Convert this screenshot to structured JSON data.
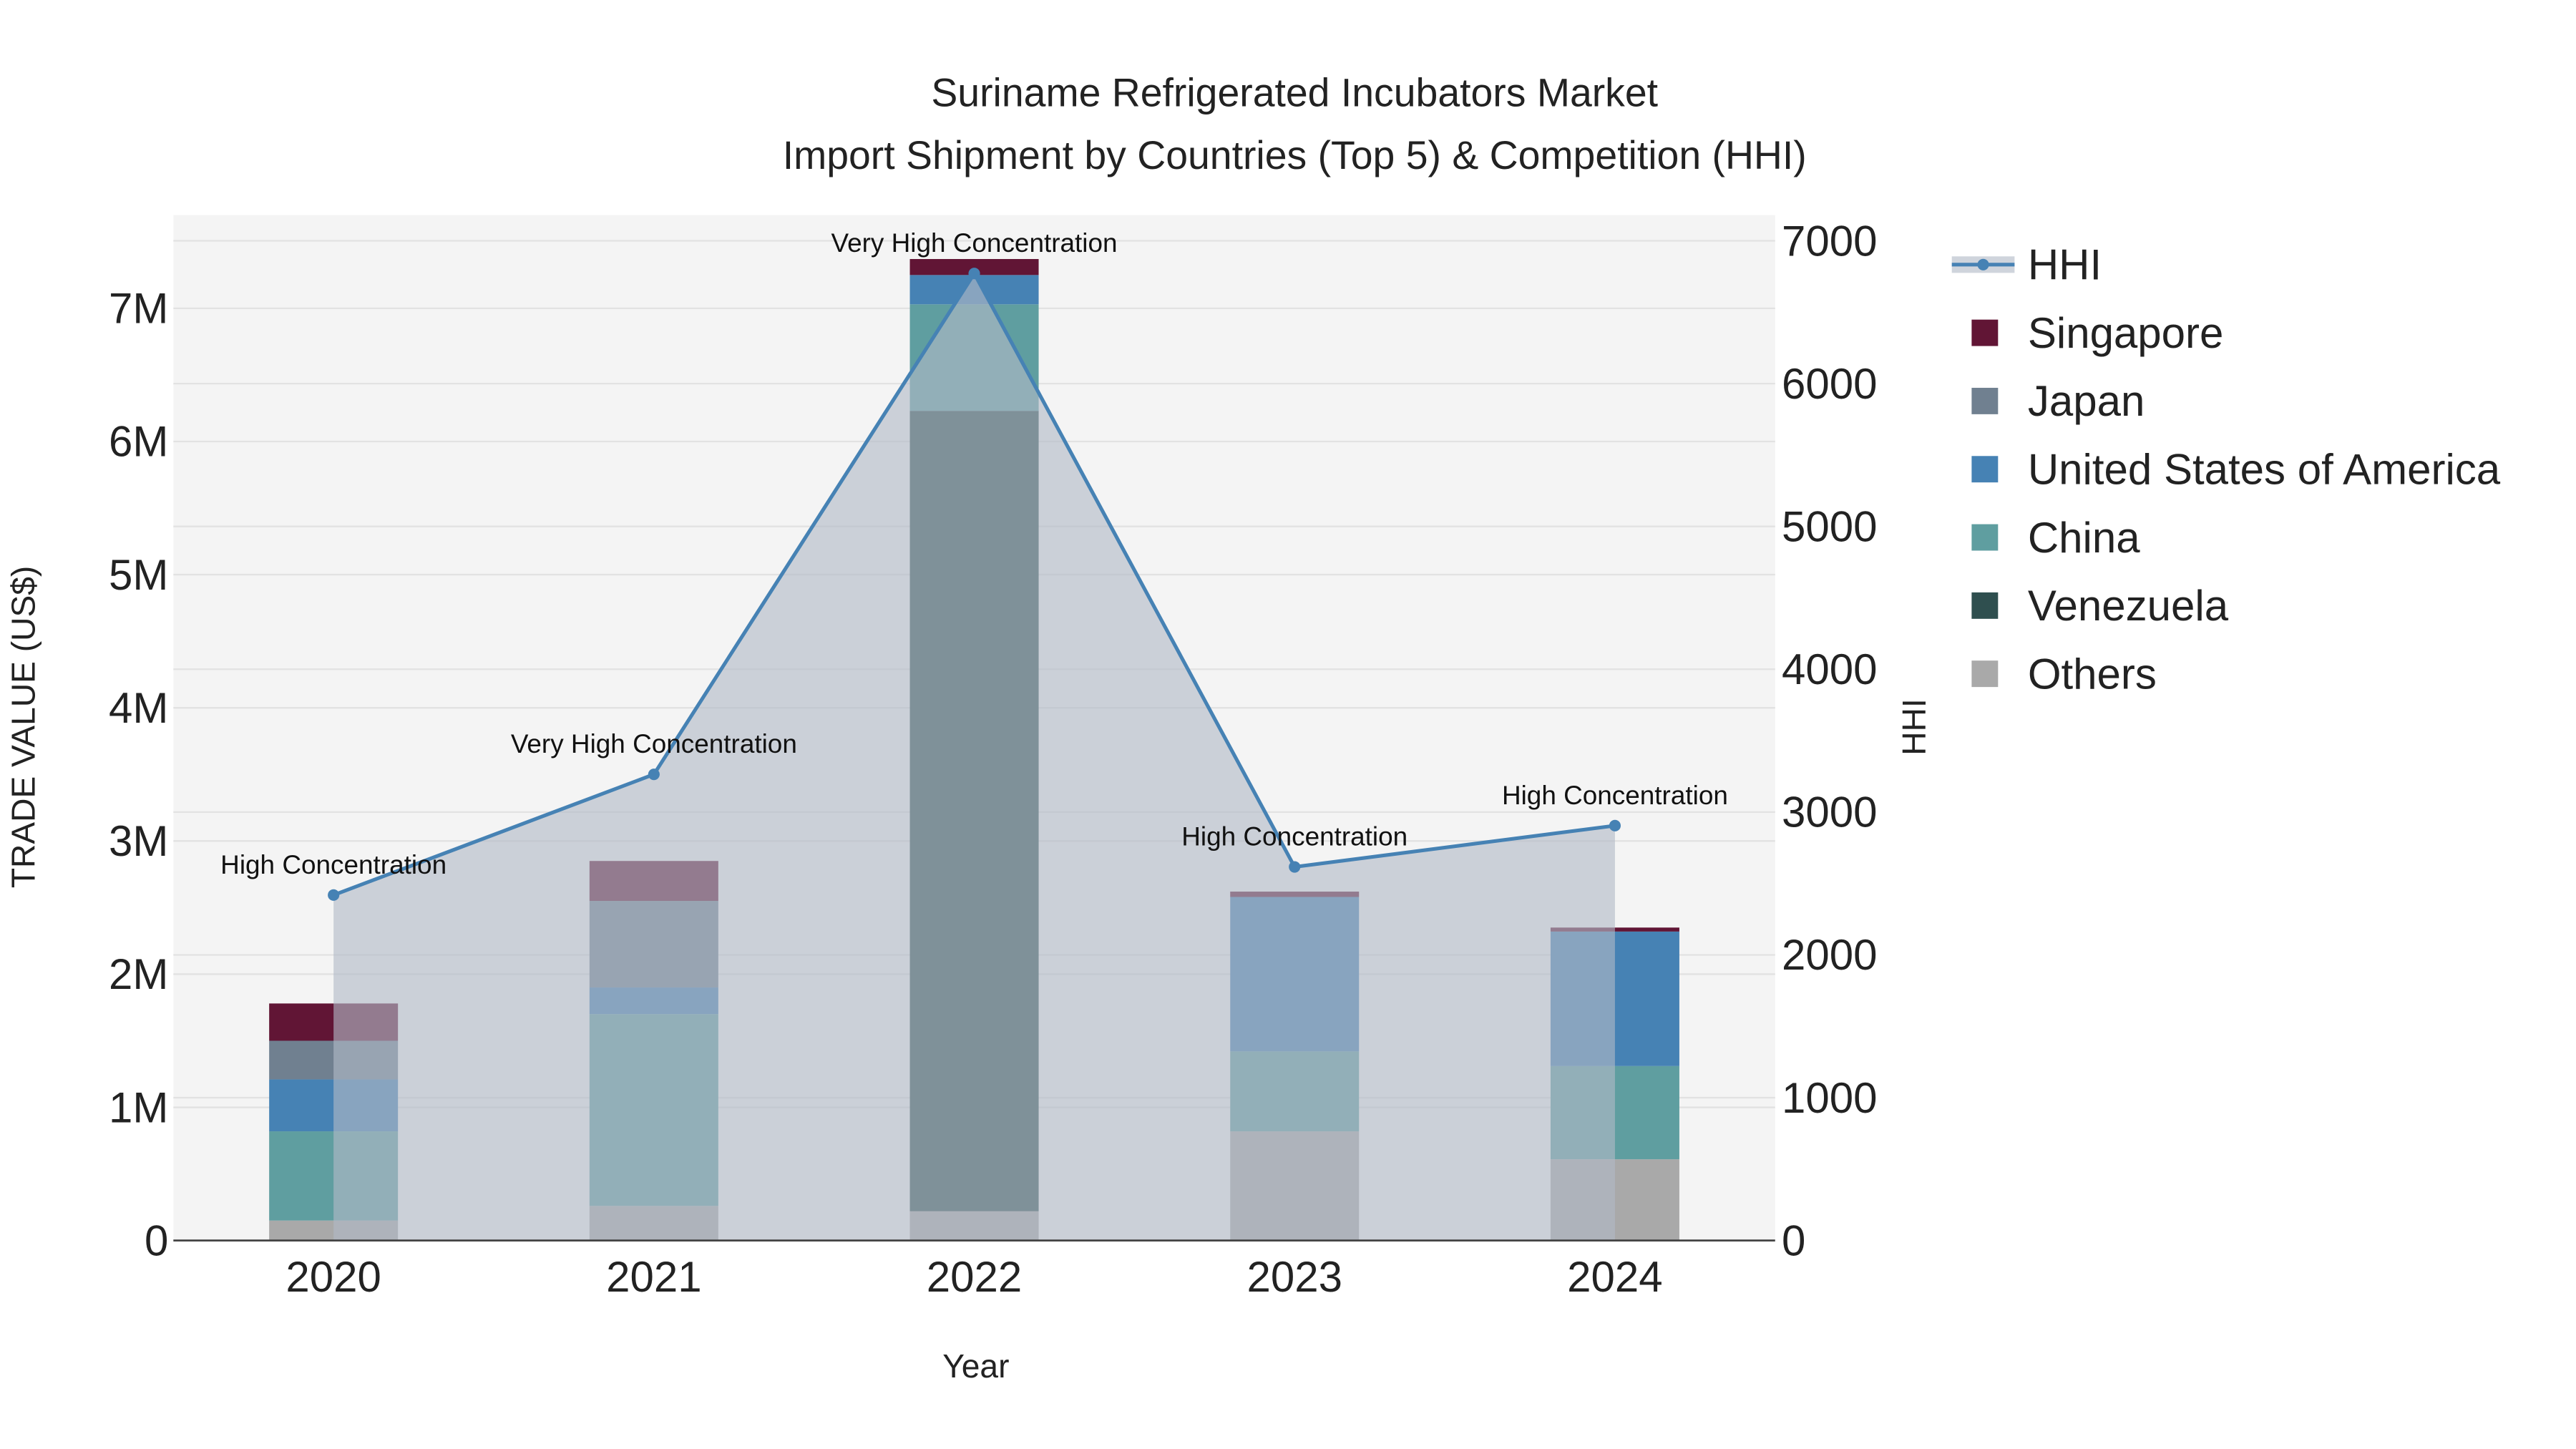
{
  "chart_data": {
    "type": "bar",
    "title_line1": "Suriname Refrigerated Incubators Market",
    "title_line2": "Import Shipment by Countries (Top 5) & Competition (HHI)",
    "xlabel": "Year",
    "ylabel": "TRADE VALUE (US$)",
    "y2label": "HHI",
    "categories": [
      "2020",
      "2021",
      "2022",
      "2023",
      "2024"
    ],
    "ylim": [
      0,
      7700000
    ],
    "y2lim": [
      0,
      7180
    ],
    "yticks": [
      0,
      1000000,
      2000000,
      3000000,
      4000000,
      5000000,
      6000000,
      7000000
    ],
    "ytick_labels": [
      "0",
      "1M",
      "2M",
      "3M",
      "4M",
      "5M",
      "6M",
      "7M"
    ],
    "y2ticks": [
      0,
      1000,
      2000,
      3000,
      4000,
      5000,
      6000,
      7000
    ],
    "y2tick_labels": [
      "0",
      "1000",
      "2000",
      "3000",
      "4000",
      "5000",
      "6000",
      "7000"
    ],
    "stacked": true,
    "series": [
      {
        "name": "Others",
        "color": "#a9a9a9",
        "values": [
          150000,
          260000,
          220000,
          820000,
          610000
        ]
      },
      {
        "name": "Venezuela",
        "color": "#2f4f4f",
        "values": [
          0,
          0,
          6010000,
          0,
          0
        ]
      },
      {
        "name": "China",
        "color": "#5f9ea0",
        "values": [
          670000,
          1440000,
          800000,
          600000,
          700000
        ]
      },
      {
        "name": "United States of America",
        "color": "#4682b4",
        "values": [
          390000,
          200000,
          220000,
          1160000,
          1010000
        ]
      },
      {
        "name": "Japan",
        "color": "#708090",
        "values": [
          290000,
          650000,
          0,
          0,
          0
        ]
      },
      {
        "name": "Singapore",
        "color": "#611535",
        "values": [
          280000,
          300000,
          120000,
          40000,
          30000
        ]
      }
    ],
    "hhi": {
      "name": "HHI",
      "color": "#4682b4",
      "values": [
        2419,
        3264,
        6771,
        2616,
        2905
      ]
    },
    "annotations": [
      "High Concentration",
      "Very High Concentration",
      "Very High Concentration",
      "High Concentration",
      "High Concentration"
    ],
    "legend": [
      "HHI",
      "Singapore",
      "Japan",
      "United States of America",
      "China",
      "Venezuela",
      "Others"
    ],
    "legend_position": "right",
    "grid": true
  }
}
